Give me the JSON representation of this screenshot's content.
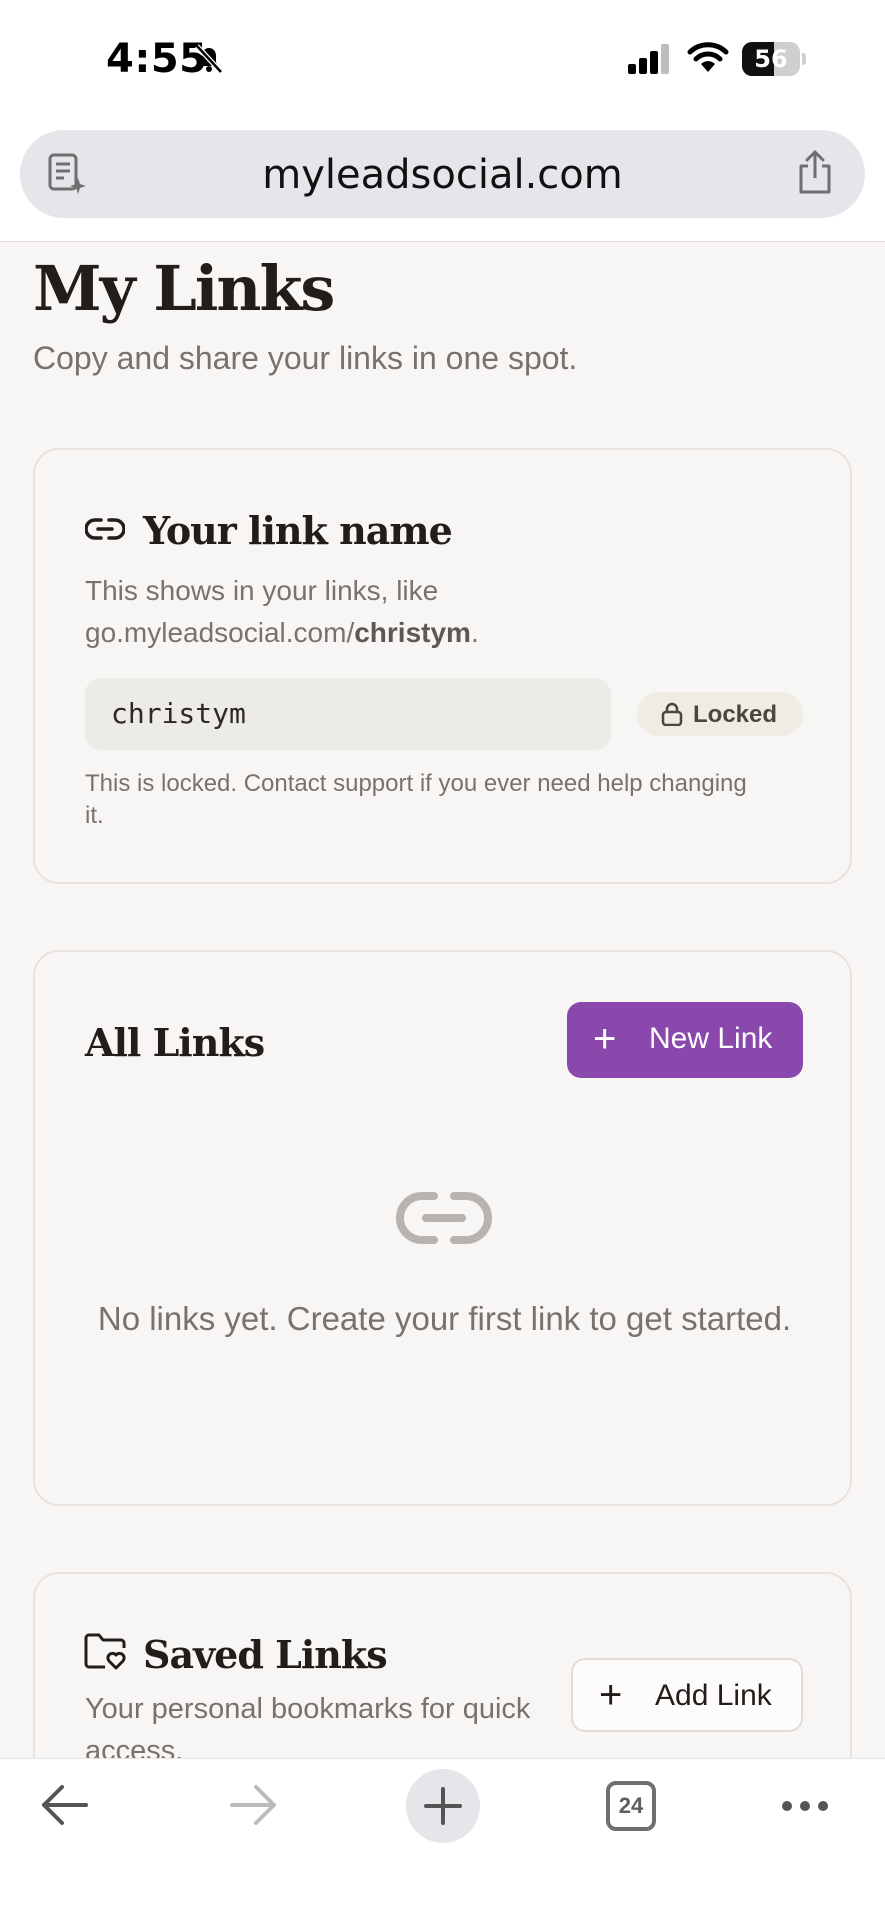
{
  "status_bar": {
    "time": "4:55",
    "battery": "56",
    "battery_level": 0.56
  },
  "browser": {
    "url": "myleadsocial.com",
    "tabs_count": "24"
  },
  "page": {
    "title": "My Links",
    "subtitle": "Copy and share your links in one spot."
  },
  "link_name_card": {
    "title": "Your link name",
    "desc_prefix": "This shows in your links, like go.myleadsocial.com/",
    "desc_slug": "christym",
    "desc_suffix": ".",
    "slug_value": "christym",
    "locked_label": "Locked",
    "note": "This is locked. Contact support if you ever need help changing it."
  },
  "all_links_card": {
    "title": "All Links",
    "new_link_label": "New Link",
    "empty_text": "No links yet. Create your first link to get started."
  },
  "saved_links_card": {
    "title": "Saved Links",
    "desc": "Your personal bookmarks for quick access.",
    "add_link_label": "Add Link"
  },
  "colors": {
    "accent": "#8a47ac",
    "muted_text": "#7a716d",
    "background": "#f8f6f4"
  }
}
